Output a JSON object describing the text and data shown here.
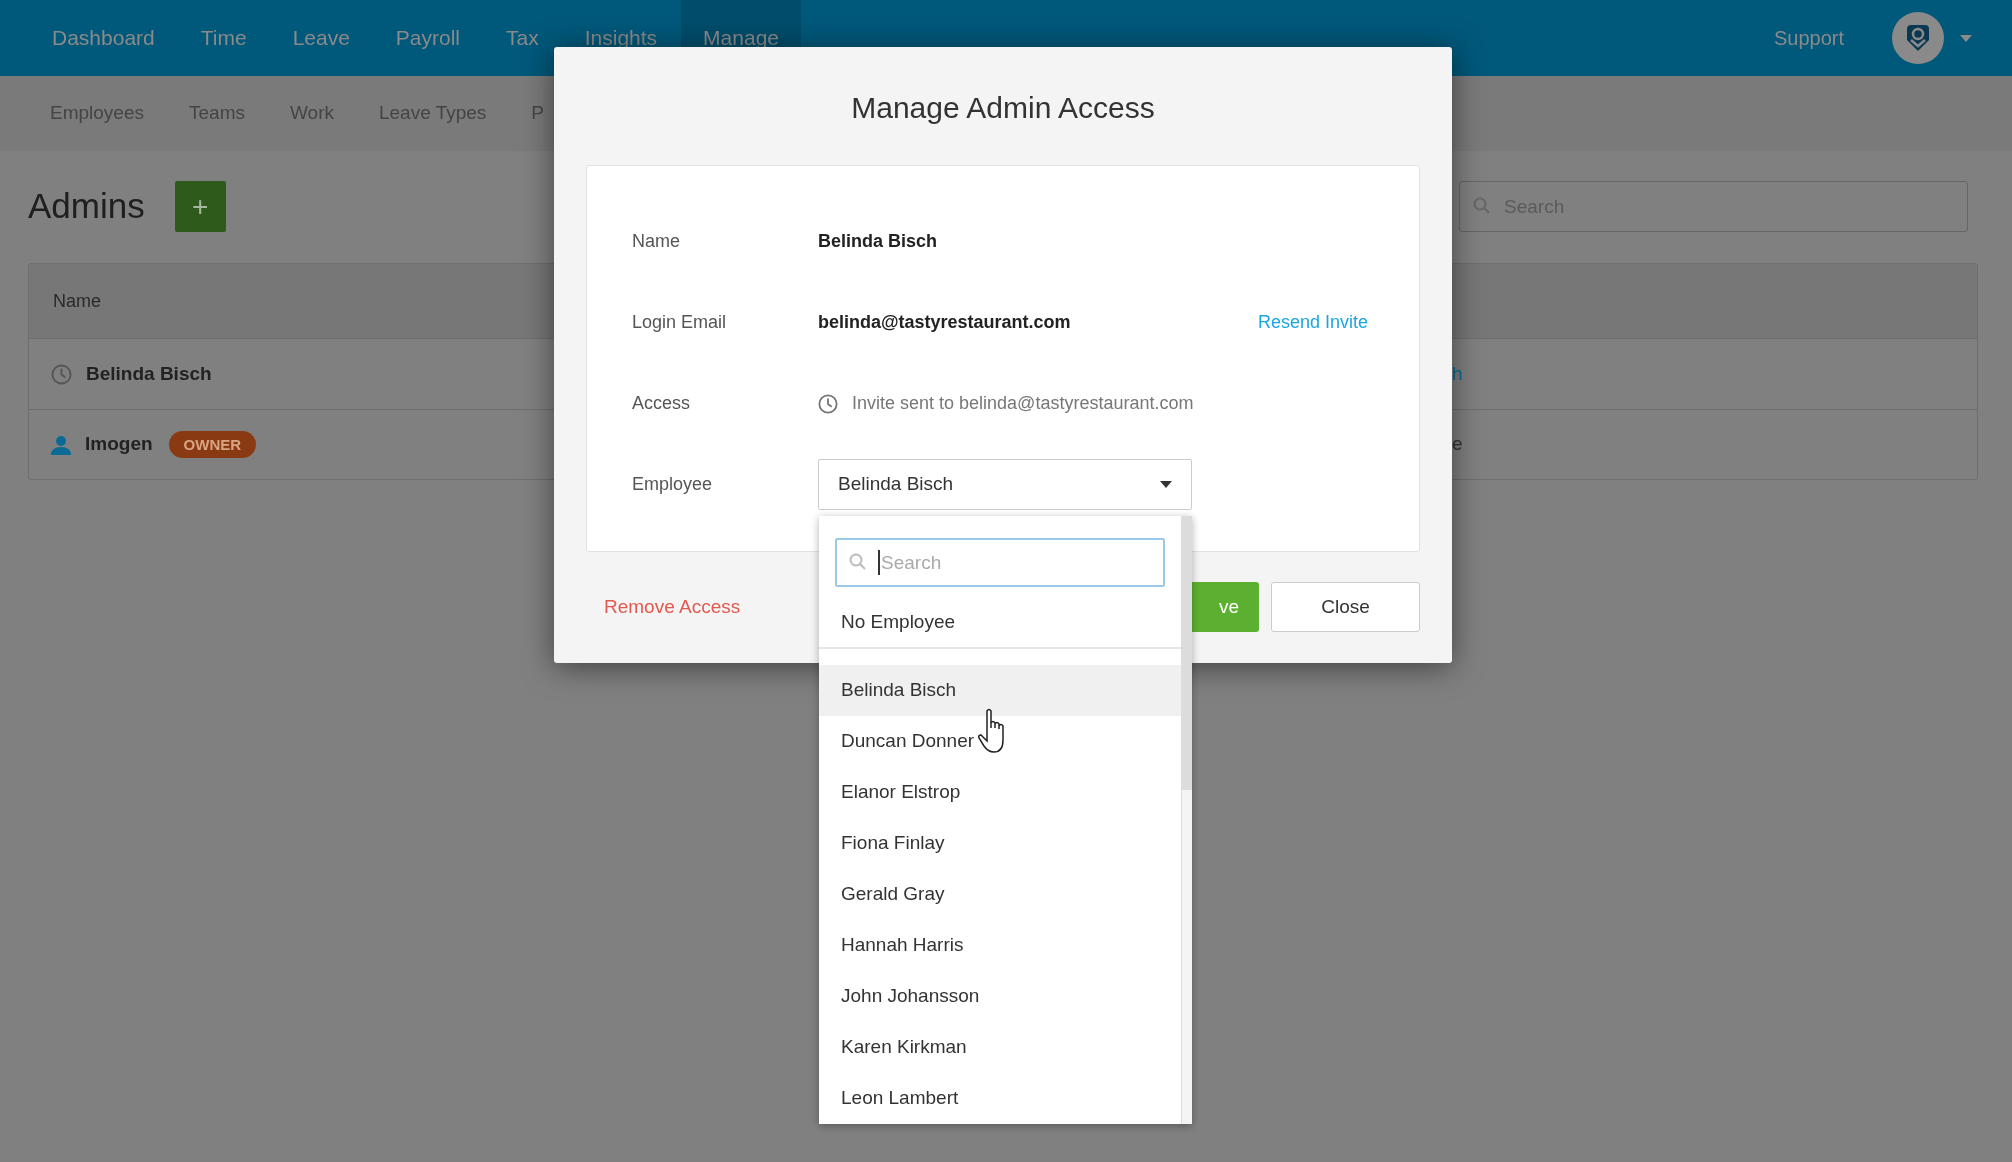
{
  "nav": {
    "items": [
      {
        "label": "Dashboard",
        "selected": false
      },
      {
        "label": "Time",
        "selected": false
      },
      {
        "label": "Leave",
        "selected": false
      },
      {
        "label": "Payroll",
        "selected": false
      },
      {
        "label": "Tax",
        "selected": false
      },
      {
        "label": "Insights",
        "selected": false
      },
      {
        "label": "Manage",
        "selected": true
      }
    ],
    "support": "Support"
  },
  "subnav": {
    "items": [
      {
        "label": "Employees"
      },
      {
        "label": "Teams"
      },
      {
        "label": "Work"
      },
      {
        "label": "Leave Types"
      },
      {
        "label": "P"
      }
    ]
  },
  "page": {
    "title": "Admins",
    "add_button": "+",
    "search": {
      "placeholder": "Search"
    },
    "table": {
      "columns": [
        "Name"
      ],
      "rows": [
        {
          "kind": "pending",
          "name": "Belinda Bisch",
          "column_2": "h"
        },
        {
          "kind": "user",
          "name": "Imogen",
          "badge": "OWNER",
          "column_2": "e"
        }
      ]
    }
  },
  "modal": {
    "title": "Manage Admin Access",
    "fields": [
      {
        "kind": "text",
        "label": "Name",
        "value": "Belinda Bisch"
      },
      {
        "kind": "email",
        "label": "Login Email",
        "value": "belinda@tastyrestaurant.com",
        "action": "Resend Invite"
      },
      {
        "kind": "status",
        "label": "Access",
        "value": "Invite sent to belinda@tastyrestaurant.com"
      },
      {
        "kind": "select",
        "label": "Employee",
        "value": "Belinda Bisch"
      }
    ],
    "remove": "Remove Access",
    "save": "ve",
    "close": "Close",
    "dropdown": {
      "search": {
        "placeholder": "Search"
      },
      "none_option": "No Employee",
      "items": [
        {
          "label": "Belinda Bisch",
          "hovered": true
        },
        {
          "label": "Duncan Donner",
          "hovered": false
        },
        {
          "label": "Elanor Elstrop",
          "hovered": false
        },
        {
          "label": "Fiona Finlay",
          "hovered": false
        },
        {
          "label": "Gerald Gray",
          "hovered": false
        },
        {
          "label": "Hannah Harris",
          "hovered": false
        },
        {
          "label": "John Johansson",
          "hovered": false
        },
        {
          "label": "Karen Kirkman",
          "hovered": false
        },
        {
          "label": "Leon Lambert",
          "hovered": false
        }
      ]
    }
  }
}
